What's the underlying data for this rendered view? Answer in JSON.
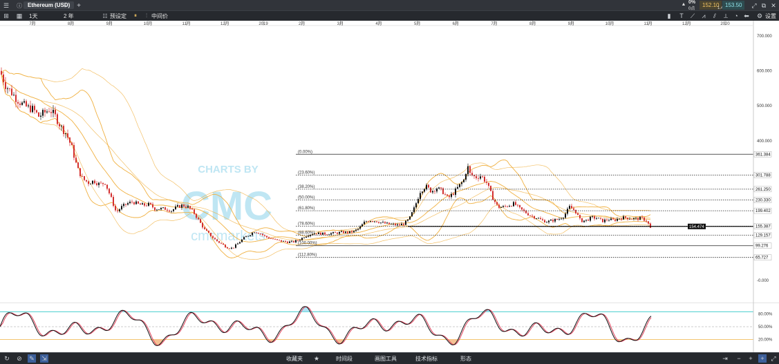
{
  "header": {
    "symbol": "Ethereum (USD)",
    "change_pct": "0%",
    "change_pts": "0点",
    "sell_price": "152.10",
    "spread": "1.40",
    "buy_price": "153.50",
    "settings_label": "设置"
  },
  "toolbar": {
    "interval": "1天",
    "range": "2 年",
    "preset_label": "预设定",
    "midprice_label": "中间价"
  },
  "footer": {
    "tabs": [
      "收藏夹",
      "时间段",
      "画图工具",
      "技术指标",
      "形态"
    ]
  },
  "watermark": {
    "line1": "CHARTS BY",
    "line2": "CMC",
    "line3": "cmcmarkets"
  },
  "colors": {
    "candle_up": "#111111",
    "candle_down": "#d32f2f",
    "bollinger": "#f0b040",
    "stoch_k": "#111111",
    "stoch_d": "#e0405a",
    "stoch_fill": "#f3b27a",
    "upper_line": "#2cc7c7",
    "watermark": "#bfe6f3"
  },
  "chart_data": [
    {
      "type": "candlestick",
      "x_tick_labels": [
        "7月",
        "8月",
        "9月",
        "10月",
        "11月",
        "12月",
        "2019",
        "2月",
        "3月",
        "4月",
        "5月",
        "6月",
        "7月",
        "8月",
        "9月",
        "10月",
        "11月",
        "12月",
        "2020"
      ],
      "y_tick_labels": [
        "700.000",
        "600.000",
        "500.000",
        "400.000",
        "-0.000"
      ],
      "y_ticks": [
        700,
        600,
        500,
        400,
        0
      ],
      "ylim": [
        -20,
        730
      ],
      "close_series_approx": [
        [
          0,
          600
        ],
        [
          8,
          560
        ],
        [
          16,
          540
        ],
        [
          24,
          520
        ],
        [
          32,
          505
        ],
        [
          40,
          495
        ],
        [
          48,
          490
        ],
        [
          56,
          470
        ],
        [
          64,
          480
        ],
        [
          72,
          490
        ],
        [
          80,
          470
        ],
        [
          88,
          440
        ],
        [
          96,
          420
        ],
        [
          104,
          380
        ],
        [
          112,
          320
        ],
        [
          120,
          290
        ],
        [
          128,
          280
        ],
        [
          136,
          285
        ],
        [
          144,
          275
        ],
        [
          152,
          280
        ],
        [
          160,
          240
        ],
        [
          168,
          195
        ],
        [
          176,
          210
        ],
        [
          184,
          220
        ],
        [
          192,
          225
        ],
        [
          200,
          218
        ],
        [
          208,
          215
        ],
        [
          216,
          218
        ],
        [
          224,
          205
        ],
        [
          232,
          205
        ],
        [
          240,
          205
        ],
        [
          248,
          200
        ],
        [
          256,
          210
        ],
        [
          264,
          215
        ],
        [
          272,
          210
        ],
        [
          280,
          195
        ],
        [
          288,
          170
        ],
        [
          296,
          145
        ],
        [
          304,
          130
        ],
        [
          312,
          115
        ],
        [
          320,
          105
        ],
        [
          328,
          95
        ],
        [
          336,
          92
        ],
        [
          344,
          105
        ],
        [
          352,
          120
        ],
        [
          360,
          130
        ],
        [
          368,
          140
        ],
        [
          376,
          135
        ],
        [
          384,
          125
        ],
        [
          392,
          120
        ],
        [
          400,
          115
        ],
        [
          408,
          112
        ],
        [
          416,
          110
        ],
        [
          424,
          110
        ],
        [
          432,
          115
        ],
        [
          440,
          125
        ],
        [
          448,
          132
        ],
        [
          456,
          135
        ],
        [
          464,
          134
        ],
        [
          472,
          133
        ],
        [
          480,
          135
        ],
        [
          488,
          136
        ],
        [
          496,
          138
        ],
        [
          504,
          137
        ],
        [
          512,
          140
        ],
        [
          520,
          150
        ],
        [
          528,
          168
        ],
        [
          536,
          172
        ],
        [
          544,
          170
        ],
        [
          552,
          165
        ],
        [
          560,
          162
        ],
        [
          568,
          160
        ],
        [
          576,
          158
        ],
        [
          584,
          162
        ],
        [
          592,
          175
        ],
        [
          600,
          210
        ],
        [
          608,
          255
        ],
        [
          616,
          270
        ],
        [
          624,
          255
        ],
        [
          632,
          265
        ],
        [
          640,
          255
        ],
        [
          648,
          235
        ],
        [
          656,
          250
        ],
        [
          664,
          270
        ],
        [
          672,
          290
        ],
        [
          676,
          330
        ],
        [
          680,
          305
        ],
        [
          688,
          295
        ],
        [
          696,
          300
        ],
        [
          704,
          280
        ],
        [
          712,
          240
        ],
        [
          720,
          210
        ],
        [
          728,
          210
        ],
        [
          736,
          215
        ],
        [
          744,
          220
        ],
        [
          752,
          205
        ],
        [
          760,
          195
        ],
        [
          768,
          185
        ],
        [
          776,
          180
        ],
        [
          784,
          172
        ],
        [
          792,
          168
        ],
        [
          800,
          172
        ],
        [
          808,
          175
        ],
        [
          816,
          185
        ],
        [
          824,
          210
        ],
        [
          832,
          200
        ],
        [
          840,
          170
        ],
        [
          848,
          172
        ],
        [
          856,
          180
        ],
        [
          864,
          178
        ],
        [
          872,
          170
        ],
        [
          880,
          175
        ],
        [
          888,
          172
        ],
        [
          896,
          178
        ],
        [
          904,
          180
        ],
        [
          912,
          178
        ],
        [
          920,
          176
        ],
        [
          928,
          178
        ],
        [
          936,
          170
        ],
        [
          942,
          145
        ]
      ],
      "fibonacci": {
        "labels": [
          "(0.00%)",
          "(23.60%)",
          "(38.20%)",
          "(50.00%)",
          "(61.80%)",
          "(78.60%)",
          "(88.60%)",
          "(100.00%)",
          "(112.80%)"
        ],
        "values": [
          361.384,
          301.788,
          261.25,
          230.33,
          199.402,
          155.387,
          129.157,
          99.276,
          65.727
        ],
        "value_labels": [
          "361.384",
          "301.788",
          "261.250",
          "230.330",
          "199.402",
          "155.387",
          "129.157",
          "99.276",
          "65.727"
        ]
      },
      "current_price": {
        "value": 154.474,
        "label": "154.474"
      }
    },
    {
      "type": "line",
      "name_hint": "stochastic",
      "y_tick_labels": [
        "80.00%",
        "50.00%",
        "20.00%"
      ],
      "y_ticks": [
        80,
        50,
        20
      ],
      "ylim": [
        0,
        100
      ],
      "levels": [
        85,
        50,
        20
      ]
    }
  ]
}
